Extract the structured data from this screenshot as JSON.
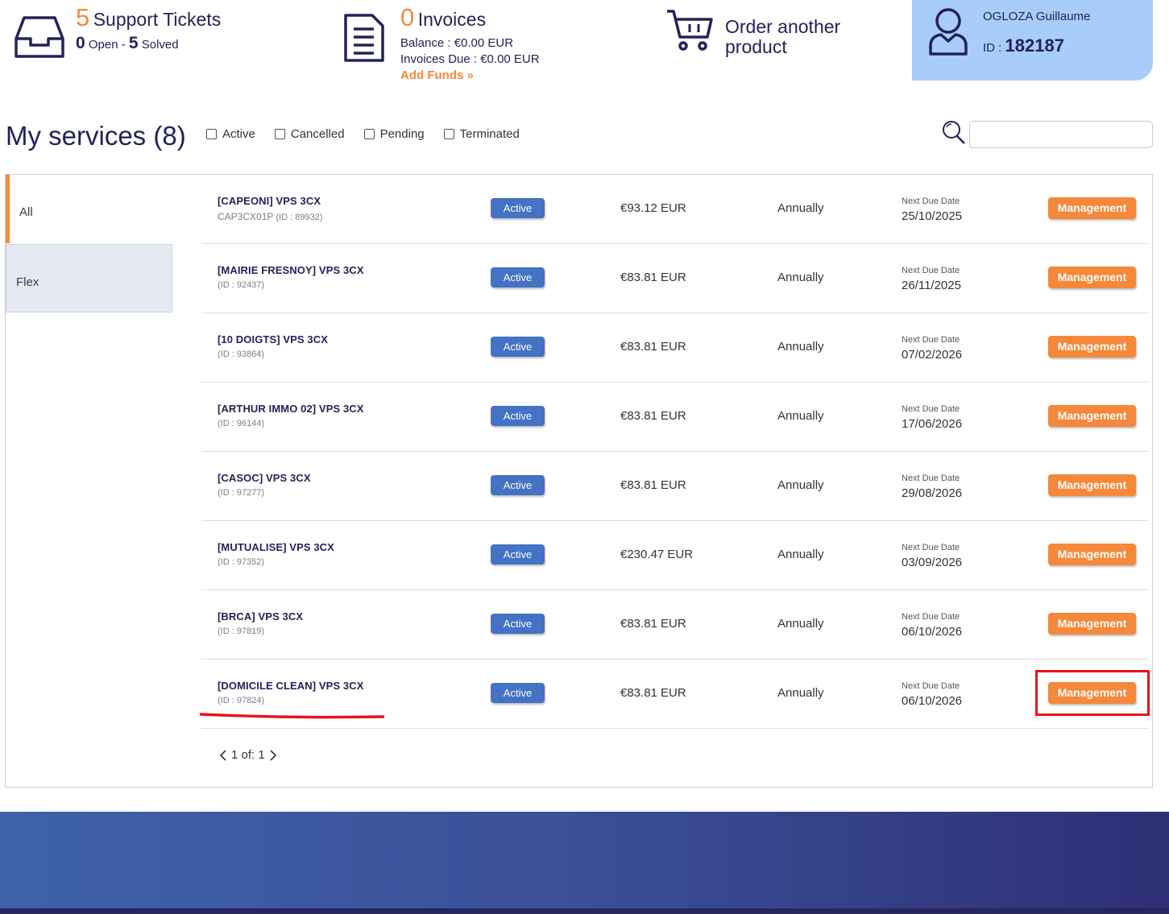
{
  "stats": {
    "tickets": {
      "count": "5",
      "title": "Support Tickets",
      "open_count": "0",
      "open_label": "Open -",
      "solved_count": "5",
      "solved_label": "Solved"
    },
    "invoices": {
      "count": "0",
      "title": "Invoices",
      "balance": "Balance : €0.00 EUR",
      "due": "Invoices Due : €0.00 EUR",
      "add_funds": "Add Funds »"
    },
    "order": {
      "line1": "Order another",
      "line2": "product"
    }
  },
  "user": {
    "name": "OGLOZA Guillaume",
    "id_label": "ID :",
    "id": "182187"
  },
  "page_title": "My services (8)",
  "filters": [
    "Active",
    "Cancelled",
    "Pending",
    "Terminated"
  ],
  "tabs": [
    "All",
    "Flex"
  ],
  "due_label": "Next Due Date",
  "manage_label": "Management",
  "services": [
    {
      "name": "[CAPEONI] VPS 3CX",
      "code": "CAP3CX01P",
      "id": "(ID : 89932)",
      "status": "Active",
      "price": "€93.12 EUR",
      "cycle": "Annually",
      "due": "25/10/2025"
    },
    {
      "name": "[MAIRIE FRESNOY] VPS 3CX",
      "code": "",
      "id": "(ID : 92437)",
      "status": "Active",
      "price": "€83.81 EUR",
      "cycle": "Annually",
      "due": "26/11/2025"
    },
    {
      "name": "[10 DOIGTS] VPS 3CX",
      "code": "",
      "id": "(ID : 93864)",
      "status": "Active",
      "price": "€83.81 EUR",
      "cycle": "Annually",
      "due": "07/02/2026"
    },
    {
      "name": "[ARTHUR IMMO 02] VPS 3CX",
      "code": "",
      "id": "(ID : 96144)",
      "status": "Active",
      "price": "€83.81 EUR",
      "cycle": "Annually",
      "due": "17/06/2026"
    },
    {
      "name": "[CASOC] VPS 3CX",
      "code": "",
      "id": "(ID : 97277)",
      "status": "Active",
      "price": "€83.81 EUR",
      "cycle": "Annually",
      "due": "29/08/2026"
    },
    {
      "name": "[MUTUALISE] VPS 3CX",
      "code": "",
      "id": "(ID : 97352)",
      "status": "Active",
      "price": "€230.47 EUR",
      "cycle": "Annually",
      "due": "03/09/2026"
    },
    {
      "name": "[BRCA] VPS 3CX",
      "code": "",
      "id": "(ID : 97819)",
      "status": "Active",
      "price": "€83.81 EUR",
      "cycle": "Annually",
      "due": "06/10/2026"
    },
    {
      "name": "[DOMICILE CLEAN] VPS 3CX",
      "code": "",
      "id": "(ID : 97824)",
      "status": "Active",
      "price": "€83.81 EUR",
      "cycle": "Annually",
      "due": "06/10/2026"
    }
  ],
  "pagination": "1 of: 1",
  "colors": {
    "accent": "#f5883a",
    "status_active": "#4472c4",
    "navy": "#232259",
    "annotation": "#e8141c"
  }
}
